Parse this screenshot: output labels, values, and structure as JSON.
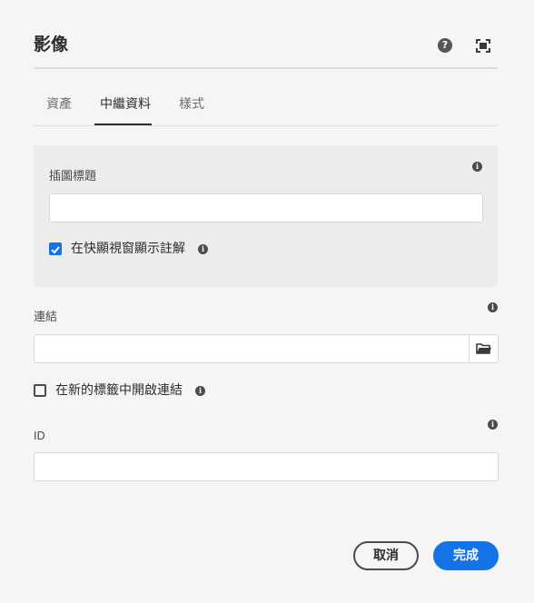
{
  "dialog": {
    "title": "影像",
    "help_glyph": "?",
    "icons": [
      "help-icon",
      "fullscreen-icon",
      "info-icon",
      "folder-icon"
    ]
  },
  "tabs": [
    {
      "label": "資產",
      "active": false
    },
    {
      "label": "中繼資料",
      "active": true
    },
    {
      "label": "樣式",
      "active": false
    }
  ],
  "metadata_panel": {
    "caption_label": "插圖標題",
    "caption_value": "",
    "caption_popup_label": "在快顯視窗顯示註解",
    "caption_popup_checked": true
  },
  "link": {
    "label": "連結",
    "value": "",
    "new_tab_label": "在新的標籤中開啟連結",
    "new_tab_checked": false
  },
  "id_field": {
    "label": "ID",
    "value": ""
  },
  "footer": {
    "cancel_label": "取消",
    "done_label": "完成"
  },
  "colors": {
    "accent": "#1473e6",
    "background": "#f5f5f5",
    "panel": "#ececec"
  }
}
